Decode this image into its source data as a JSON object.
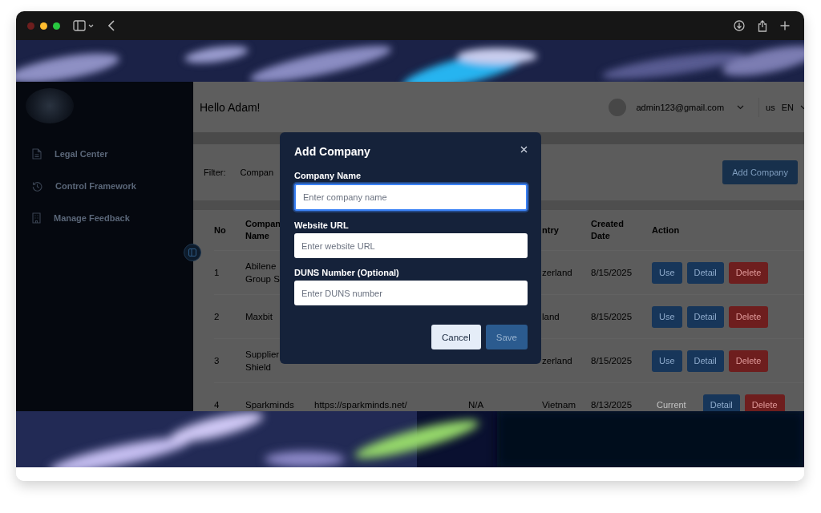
{
  "sidebar": {
    "items": [
      {
        "label": "Legal Center",
        "kind": "document"
      },
      {
        "label": "Control Framework",
        "kind": "history"
      },
      {
        "label": "Manage Feedback",
        "kind": "building"
      }
    ]
  },
  "header": {
    "greeting": "Hello Adam!",
    "email": "admin123@gmail.com",
    "language": {
      "flag": "us",
      "code": "EN"
    }
  },
  "filter": {
    "label": "Filter:",
    "placeholder": "Compan",
    "add_button": "Add Company"
  },
  "table": {
    "columns": {
      "no": "No",
      "company": "Compan Name",
      "country": "ntry",
      "created": "Created Date",
      "action": "Action"
    },
    "rows": [
      {
        "no": "1",
        "company": "Abilene Group S",
        "country": "zerland",
        "created": "8/15/2025",
        "actions": [
          {
            "label": "Use",
            "kind": "use"
          },
          {
            "label": "Detail",
            "kind": "detail"
          },
          {
            "label": "Delete",
            "kind": "delete"
          }
        ]
      },
      {
        "no": "2",
        "company": "Maxbit",
        "country": "land",
        "created": "8/15/2025",
        "actions": [
          {
            "label": "Use",
            "kind": "use"
          },
          {
            "label": "Detail",
            "kind": "detail"
          },
          {
            "label": "Delete",
            "kind": "delete"
          }
        ]
      },
      {
        "no": "3",
        "company": "Supplier Shield",
        "country": "zerland",
        "created": "8/15/2025",
        "actions": [
          {
            "label": "Use",
            "kind": "use"
          },
          {
            "label": "Detail",
            "kind": "detail"
          },
          {
            "label": "Delete",
            "kind": "delete"
          }
        ]
      },
      {
        "no": "4",
        "company": "Sparkminds",
        "website": "https://sparkminds.net/",
        "column_4": "N/A",
        "country": "Vietnam",
        "created": "8/13/2025",
        "actions": [
          {
            "label": "Current",
            "kind": "current"
          },
          {
            "label": "Detail",
            "kind": "detail"
          },
          {
            "label": "Delete",
            "kind": "delete"
          }
        ]
      }
    ]
  },
  "modal": {
    "title": "Add Company",
    "fields": [
      {
        "label": "Company Name",
        "placeholder": "Enter company name",
        "focused": true
      },
      {
        "label": "Website URL",
        "placeholder": "Enter website URL",
        "focused": false
      },
      {
        "label": "DUNS Number (Optional)",
        "placeholder": "Enter DUNS number",
        "focused": false
      }
    ],
    "buttons": [
      {
        "label": "Cancel",
        "kind": "cancel"
      },
      {
        "label": "Save",
        "kind": "save"
      }
    ]
  }
}
